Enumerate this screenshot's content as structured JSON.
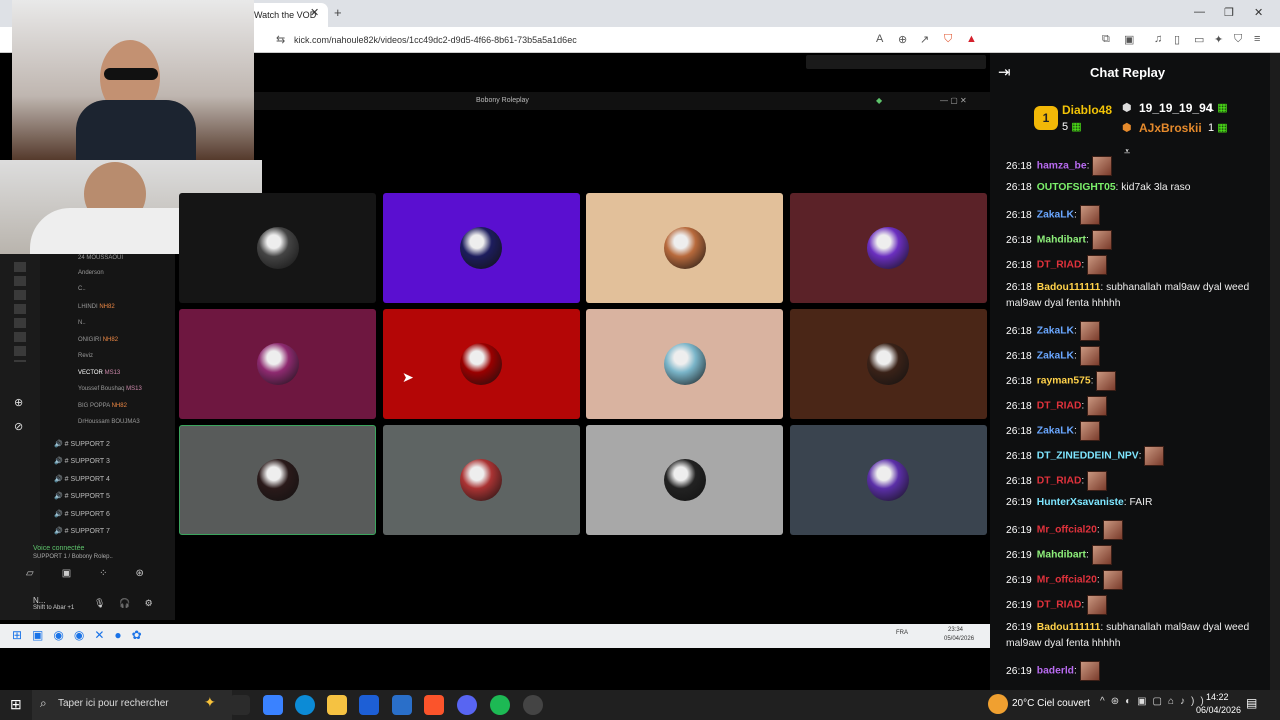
{
  "browser": {
    "tab_title": "Watch the VOD",
    "url": "kick.com/nahoule82k/videos/1cc49dc2-d9d5-4f66-8b61-73b5a5a1d6ec"
  },
  "discord": {
    "window_title": "Bobony Roleplay",
    "members": [
      "24 MOUSSAOUI",
      "Anderson",
      "C..",
      "LHINDI",
      "N..",
      "ONIGIRI",
      "Reviz",
      "VECTOR",
      "Youssef Boushaq",
      "BIG POPPA",
      "DrHoussam BOUJMA3"
    ],
    "member_tags": {
      "LHINDI": "NH82",
      "ONIGIRI": "NH82",
      "VECTOR": "MS13",
      "Youssef Boushaq": "MS13",
      "BIG POPPA": "NH82"
    },
    "support_channels": [
      "SUPPORT 2",
      "SUPPORT 3",
      "SUPPORT 4",
      "SUPPORT 5",
      "SUPPORT 6",
      "SUPPORT 7"
    ],
    "voice_status": "Voice connectée",
    "voice_channel": "SUPPORT 1 / Bobony Rolep..",
    "user_name": "N...",
    "user_sub": "Shift to Abar +1",
    "tile_colors": [
      "#151515",
      "#5a0fd0",
      "#e2c09a",
      "#5b2228",
      "#6e1740",
      "#b40606",
      "#d9b3a0",
      "#4a2617",
      "#585b5a",
      "#5e6463",
      "#a8a8a8",
      "#3a444f"
    ],
    "inner_clock": "23:34",
    "inner_date": "05/04/2026",
    "inner_lang": "FRA"
  },
  "chat": {
    "title": "Chat Replay",
    "leaderboard": {
      "first_name": "Diablo48",
      "first_count": "5",
      "second_name": "19_19_19_94",
      "second_count": "1",
      "third_name": "AJxBroskii",
      "third_count": "1"
    },
    "messages": [
      {
        "time": "26:18",
        "user": "hamza_be",
        "color": "#b86bf0",
        "text": ""
      },
      {
        "time": "26:18",
        "user": "OUTOFSIGHT05",
        "color": "#7cf06b",
        "text": "kid7ak 3la raso"
      },
      {
        "time": "26:18",
        "user": "ZakaLK",
        "color": "#6aa7ff",
        "text": ""
      },
      {
        "time": "26:18",
        "user": "Mahdibart",
        "color": "#8ef07b",
        "text": ""
      },
      {
        "time": "26:18",
        "user": "DT_RIAD",
        "color": "#e0323c",
        "text": ""
      },
      {
        "time": "26:18",
        "user": "Badou111111",
        "color": "#ffd24a",
        "text": "subhanallah mal9aw dyal weed mal9aw dyal fenta hhhhh"
      },
      {
        "time": "26:18",
        "user": "ZakaLK",
        "color": "#6aa7ff",
        "text": ""
      },
      {
        "time": "26:18",
        "user": "ZakaLK",
        "color": "#6aa7ff",
        "text": ""
      },
      {
        "time": "26:18",
        "user": "rayman575",
        "color": "#ffd24a",
        "text": ""
      },
      {
        "time": "26:18",
        "user": "DT_RIAD",
        "color": "#e0323c",
        "text": ""
      },
      {
        "time": "26:18",
        "user": "ZakaLK",
        "color": "#6aa7ff",
        "text": ""
      },
      {
        "time": "26:18",
        "user": "DT_ZINEDDEIN_NPV",
        "color": "#7ee6ff",
        "text": ""
      },
      {
        "time": "26:18",
        "user": "DT_RIAD",
        "color": "#e0323c",
        "text": ""
      },
      {
        "time": "26:19",
        "user": "HunterXsavaniste",
        "color": "#7ee6ff",
        "text": "FAIR"
      },
      {
        "time": "26:19",
        "user": "Mr_offcial20",
        "color": "#e0323c",
        "text": ""
      },
      {
        "time": "26:19",
        "user": "Mahdibart",
        "color": "#8ef07b",
        "text": ""
      },
      {
        "time": "26:19",
        "user": "Mr_offcial20",
        "color": "#e0323c",
        "text": ""
      },
      {
        "time": "26:19",
        "user": "DT_RIAD",
        "color": "#e0323c",
        "text": ""
      },
      {
        "time": "26:19",
        "user": "Badou111111",
        "color": "#ffd24a",
        "text": "subhanallah mal9aw dyal weed mal9aw dyal fenta hhhhh"
      },
      {
        "time": "26:19",
        "user": "baderld",
        "color": "#b86bf0",
        "text": ""
      }
    ]
  },
  "taskbar": {
    "search_placeholder": "Taper ici pour rechercher",
    "weather": "20°C  Ciel couvert",
    "time": "14:22",
    "date": "06/04/2026"
  }
}
